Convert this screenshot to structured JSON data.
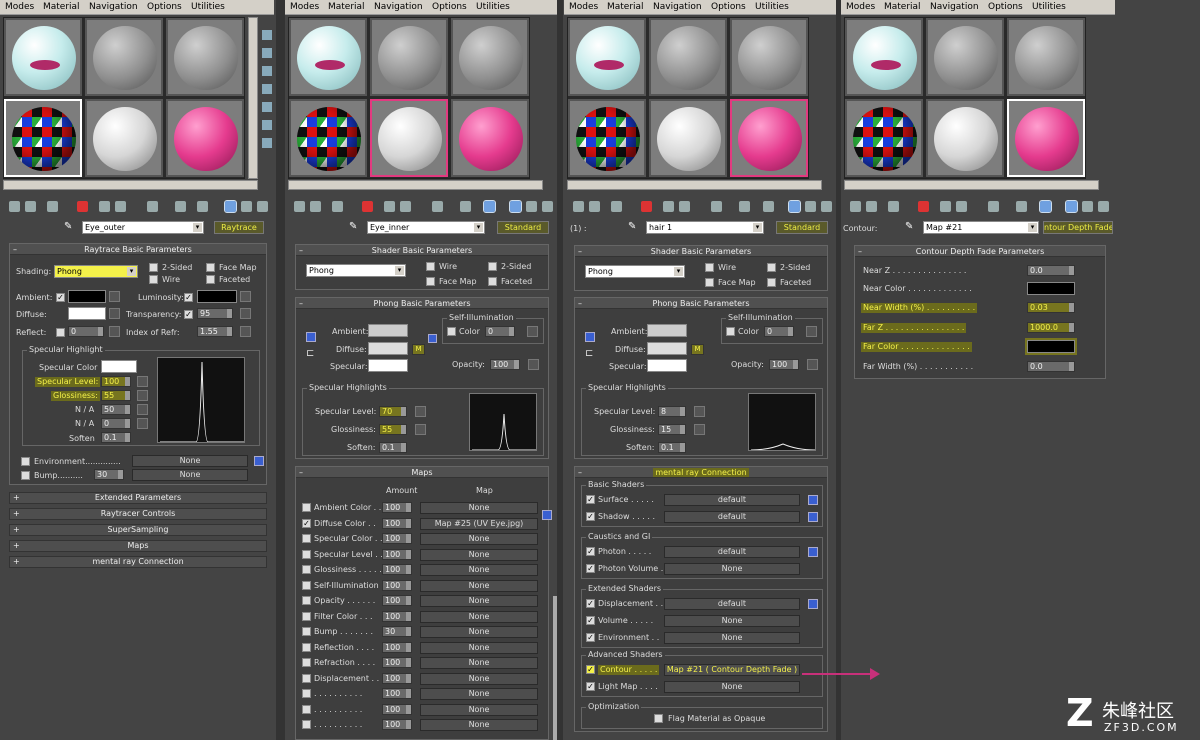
{
  "menu": [
    "Modes",
    "Material",
    "Navigation",
    "Options",
    "Utilities"
  ],
  "panel1": {
    "material_name": "Eye_outer",
    "type_label": "Raytrace",
    "rollout_title": "Raytrace Basic Parameters",
    "shading_label": "Shading:",
    "shading_value": "Phong",
    "opt_2sided": "2-Sided",
    "opt_wire": "Wire",
    "opt_facemap": "Face Map",
    "opt_faceted": "Faceted",
    "ambient_label": "Ambient:",
    "luminosity_label": "Luminosity:",
    "diffuse_label": "Diffuse:",
    "transparency_label": "Transparency:",
    "transparency_value": "95",
    "reflect_label": "Reflect:",
    "reflect_value": "0",
    "ior_label": "Index of Refr:",
    "ior_value": "1.55",
    "spec_group": "Specular Highlight",
    "spec_color_label": "Specular Color",
    "spec_level_label": "Specular Level:",
    "spec_level_value": "100",
    "glossiness_label": "Glossiness:",
    "glossiness_value": "55",
    "na1": "N / A",
    "na1_value": "50",
    "na2": "N / A",
    "na2_value": "0",
    "soften_label": "Soften",
    "soften_value": "0.1",
    "env_label": "Environment..............",
    "env_value": "None",
    "bump_label": "Bump..........",
    "bump_amount": "30",
    "bump_value": "None",
    "rollouts": [
      "Extended Parameters",
      "Raytracer Controls",
      "SuperSampling",
      "Maps",
      "mental ray Connection"
    ]
  },
  "panel2": {
    "material_name": "Eye_inner",
    "type_label": "Standard",
    "shader_title": "Shader Basic Parameters",
    "shader_value": "Phong",
    "opt_wire": "Wire",
    "opt_2sided": "2-Sided",
    "opt_facemap": "Face Map",
    "opt_faceted": "Faceted",
    "phong_title": "Phong Basic Parameters",
    "selfillum_group": "Self-Illumination",
    "color_label": "Color",
    "color_value": "0",
    "ambient_label": "Ambient:",
    "diffuse_label": "Diffuse:",
    "specular_label": "Specular:",
    "m_label": "M",
    "opacity_label": "Opacity:",
    "opacity_value": "100",
    "spec_group": "Specular Highlights",
    "spec_level_label": "Specular Level:",
    "spec_level_value": "70",
    "glossiness_label": "Glossiness:",
    "glossiness_value": "55",
    "soften_label": "Soften:",
    "soften_value": "0.1",
    "maps_title": "Maps",
    "amount_header": "Amount",
    "map_header": "Map",
    "maps": [
      {
        "name": "Ambient Color . .",
        "amount": "100",
        "map": "None"
      },
      {
        "name": "Diffuse Color . .",
        "amount": "100",
        "map": "Map #25 (UV Eye.jpg)"
      },
      {
        "name": "Specular Color . .",
        "amount": "100",
        "map": "None"
      },
      {
        "name": "Specular Level . .",
        "amount": "100",
        "map": "None"
      },
      {
        "name": "Glossiness . . . . .",
        "amount": "100",
        "map": "None"
      },
      {
        "name": "Self-Illumination .",
        "amount": "100",
        "map": "None"
      },
      {
        "name": "Opacity . . . . . .",
        "amount": "100",
        "map": "None"
      },
      {
        "name": "Filter Color . . .",
        "amount": "100",
        "map": "None"
      },
      {
        "name": "Bump . . . . . . .",
        "amount": "30",
        "map": "None"
      },
      {
        "name": "Reflection . . . .",
        "amount": "100",
        "map": "None"
      },
      {
        "name": "Refraction . . . .",
        "amount": "100",
        "map": "None"
      },
      {
        "name": "Displacement . . .",
        "amount": "100",
        "map": "None"
      },
      {
        "name": ". . . . . . . . . .",
        "amount": "100",
        "map": "None"
      },
      {
        "name": ". . . . . . . . . .",
        "amount": "100",
        "map": "None"
      },
      {
        "name": ". . . . . . . . . .",
        "amount": "100",
        "map": "None"
      }
    ]
  },
  "panel3": {
    "prefix": "(1) :",
    "material_name": "hair 1",
    "type_label": "Standard",
    "shader_title": "Shader Basic Parameters",
    "shader_value": "Phong",
    "opt_wire": "Wire",
    "opt_2sided": "2-Sided",
    "opt_facemap": "Face Map",
    "opt_faceted": "Faceted",
    "phong_title": "Phong Basic Parameters",
    "selfillum_group": "Self-Illumination",
    "color_label": "Color",
    "color_value": "0",
    "ambient_label": "Ambient:",
    "diffuse_label": "Diffuse:",
    "specular_label": "Specular:",
    "m_label": "M",
    "opacity_label": "Opacity:",
    "opacity_value": "100",
    "spec_group": "Specular Highlights",
    "spec_level_label": "Specular Level:",
    "spec_level_value": "8",
    "glossiness_label": "Glossiness:",
    "glossiness_value": "15",
    "soften_label": "Soften:",
    "soften_value": "0.1",
    "mr_title": "mental ray Connection",
    "groups": [
      {
        "title": "Basic Shaders",
        "rows": [
          {
            "name": "Surface . . . . .",
            "value": "default"
          },
          {
            "name": "Shadow . . . . .",
            "value": "default"
          }
        ]
      },
      {
        "title": "Caustics and GI",
        "rows": [
          {
            "name": "Photon . . . . .",
            "value": "default"
          },
          {
            "name": "Photon Volume .",
            "value": "None"
          }
        ]
      },
      {
        "title": "Extended Shaders",
        "rows": [
          {
            "name": "Displacement . .",
            "value": "default"
          },
          {
            "name": "Volume . . . . .",
            "value": "None"
          },
          {
            "name": "Environment . .",
            "value": "None"
          }
        ]
      },
      {
        "title": "Advanced Shaders",
        "rows": [
          {
            "name": "Contour . . . . .",
            "value": "Map #21  ( Contour Depth Fade )"
          },
          {
            "name": "Light Map . . . .",
            "value": "None"
          }
        ]
      }
    ],
    "opt_group": "Optimization",
    "flag_label": "Flag Material as Opaque"
  },
  "panel4": {
    "prefix": "Contour:",
    "material_name": "Map #21",
    "type_label": "ntour Depth Fade",
    "rollout_title": "Contour Depth Fade Parameters",
    "near_z_label": "Near Z . . . . . . . . . . . . . . .",
    "near_z_value": "0.0",
    "near_color_label": "Near Color . . . . . . . . . . . . .",
    "near_width_label": "Near Width (%) . . . . . . . . . .",
    "near_width_value": "0.03",
    "far_z_label": "Far Z . . . . . . . . . . . . . . . .",
    "far_z_value": "1000.0",
    "far_color_label": "Far Color . . . . . . . . . . . . . .",
    "far_width_label": "Far Width (%) . . . . . . . . . . .",
    "far_width_value": "0.0"
  },
  "watermark": {
    "brand_cn": "朱峰社区",
    "brand_url": "ZF3D.COM"
  },
  "colors": {
    "highlight": "#f4f14a",
    "pink": "#e23a80",
    "arrow": "#c8307a"
  }
}
